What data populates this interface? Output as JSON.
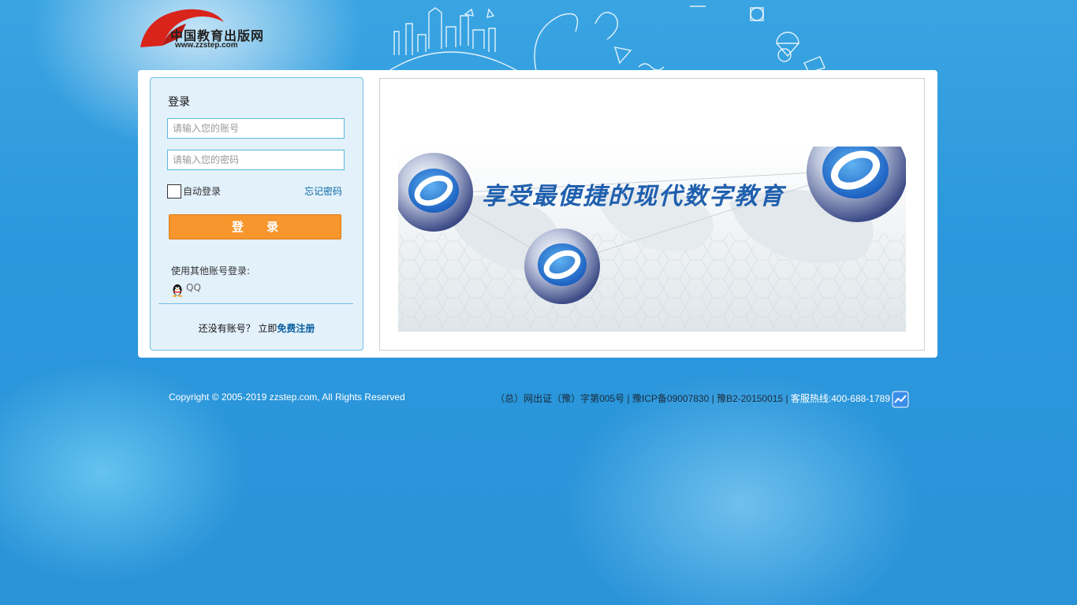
{
  "brand": {
    "name": "中国教育出版网",
    "url": "www.zzstep.com"
  },
  "login": {
    "title": "登录",
    "username_placeholder": "请输入您的账号",
    "password_placeholder": "请输入您的密码",
    "auto_login_label": "自动登录",
    "forgot_password": "忘记密码",
    "submit_label": "登 录",
    "other_accounts_label": "使用其他账号登录:",
    "qq_label": "QQ",
    "no_account_text": "还没有账号？ 立即",
    "register_label": "免费注册"
  },
  "banner": {
    "slogan": "享受最便捷的现代数字教育"
  },
  "footer": {
    "copyright": "Copyright © 2005-2019 zzstep.com, All Rights Reserved",
    "license": "（总）网出证（豫）字第005号 | 豫ICP备09007830 | 豫B2-20150015 | ",
    "hotline": "客服热线:400-688-1789"
  },
  "colors": {
    "background": "#2b98dd",
    "login_button": "#f7962d",
    "link": "#0a6aa5"
  },
  "icons": [
    "logo-swoosh-icon",
    "qq-penguin-icon",
    "stats-chart-icon"
  ]
}
